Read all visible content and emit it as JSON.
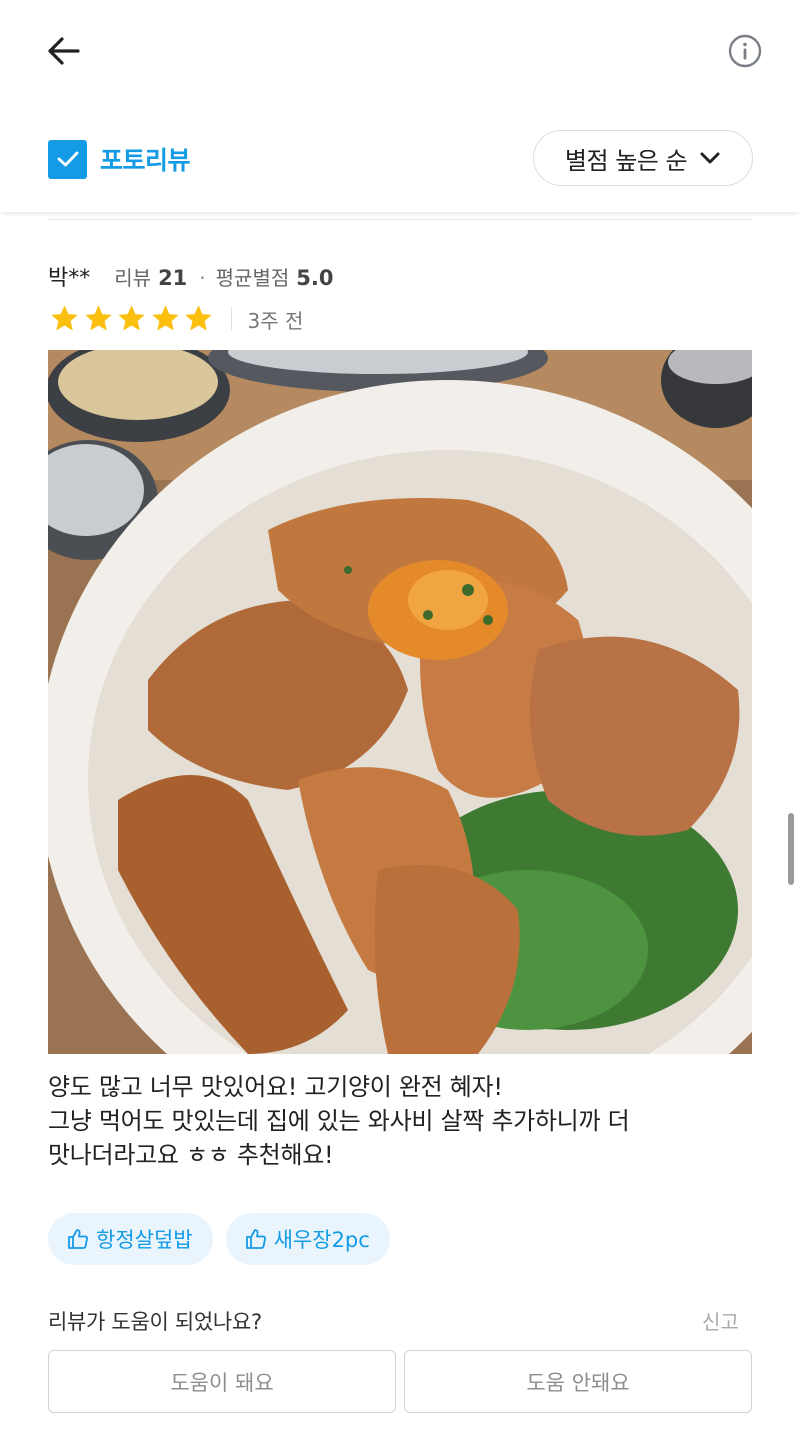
{
  "header": {
    "back_icon": "arrow-left-icon",
    "info_icon": "info-circle-icon"
  },
  "filter": {
    "photo_review_label": "포토리뷰",
    "photo_review_checked": true,
    "sort_label": "별점 높은 순"
  },
  "review": {
    "reviewer_name": "박**",
    "review_count_label": "리뷰",
    "review_count": "21",
    "avg_rating_label": "평균별점",
    "avg_rating": "5.0",
    "stars": 5,
    "time": "3주 전",
    "text_lines": [
      "양도 많고 너무 맛있어요! 고기양이 완전 혜자!",
      "그냥 먹어도 맛있는데 집에 있는 와사비 살짝 추가하니까 더",
      "맛나더라고요 ㅎㅎ 추천해요!"
    ],
    "menu_tags": [
      "항정살덮밥",
      "새우장2pc"
    ]
  },
  "feedback": {
    "question": "리뷰가 도움이 되었나요?",
    "report": "신고",
    "helpful": "도움이 돼요",
    "not_helpful": "도움 안돼요"
  },
  "colors": {
    "accent": "#139be6",
    "star": "#fbbf0f",
    "tag_bg": "#eaf4fd"
  }
}
